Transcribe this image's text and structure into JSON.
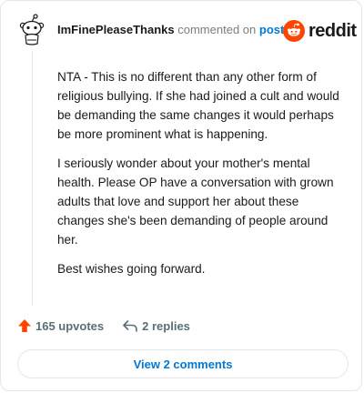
{
  "header": {
    "author": "ImFinePleaseThanks",
    "verb": "commented on",
    "link": "post"
  },
  "logo": {
    "wordmark": "reddit",
    "icon": "reddit-snoo-icon",
    "accent": "#ff4500"
  },
  "comment": {
    "paragraphs": [
      "NTA - This is no different than any other form of religious bullying. If she had joined a cult and would be demanding the same changes it would perhaps be more prominent what is happening.",
      "I seriously wonder about your mother's mental health. Please OP have a conversation with grown adults that love and support her about these changes she's been demanding of people around her.",
      "Best wishes going forward."
    ]
  },
  "actions": {
    "upvotes": "165 upvotes",
    "upvote_icon": "upvote-arrow-icon",
    "upvote_color": "#ff4500",
    "replies": "2 replies",
    "reply_icon": "reply-arrow-icon"
  },
  "view_comments": "View 2 comments",
  "colors": {
    "link": "#0079d3",
    "muted": "#576f76",
    "border": "#e4e6e8"
  }
}
